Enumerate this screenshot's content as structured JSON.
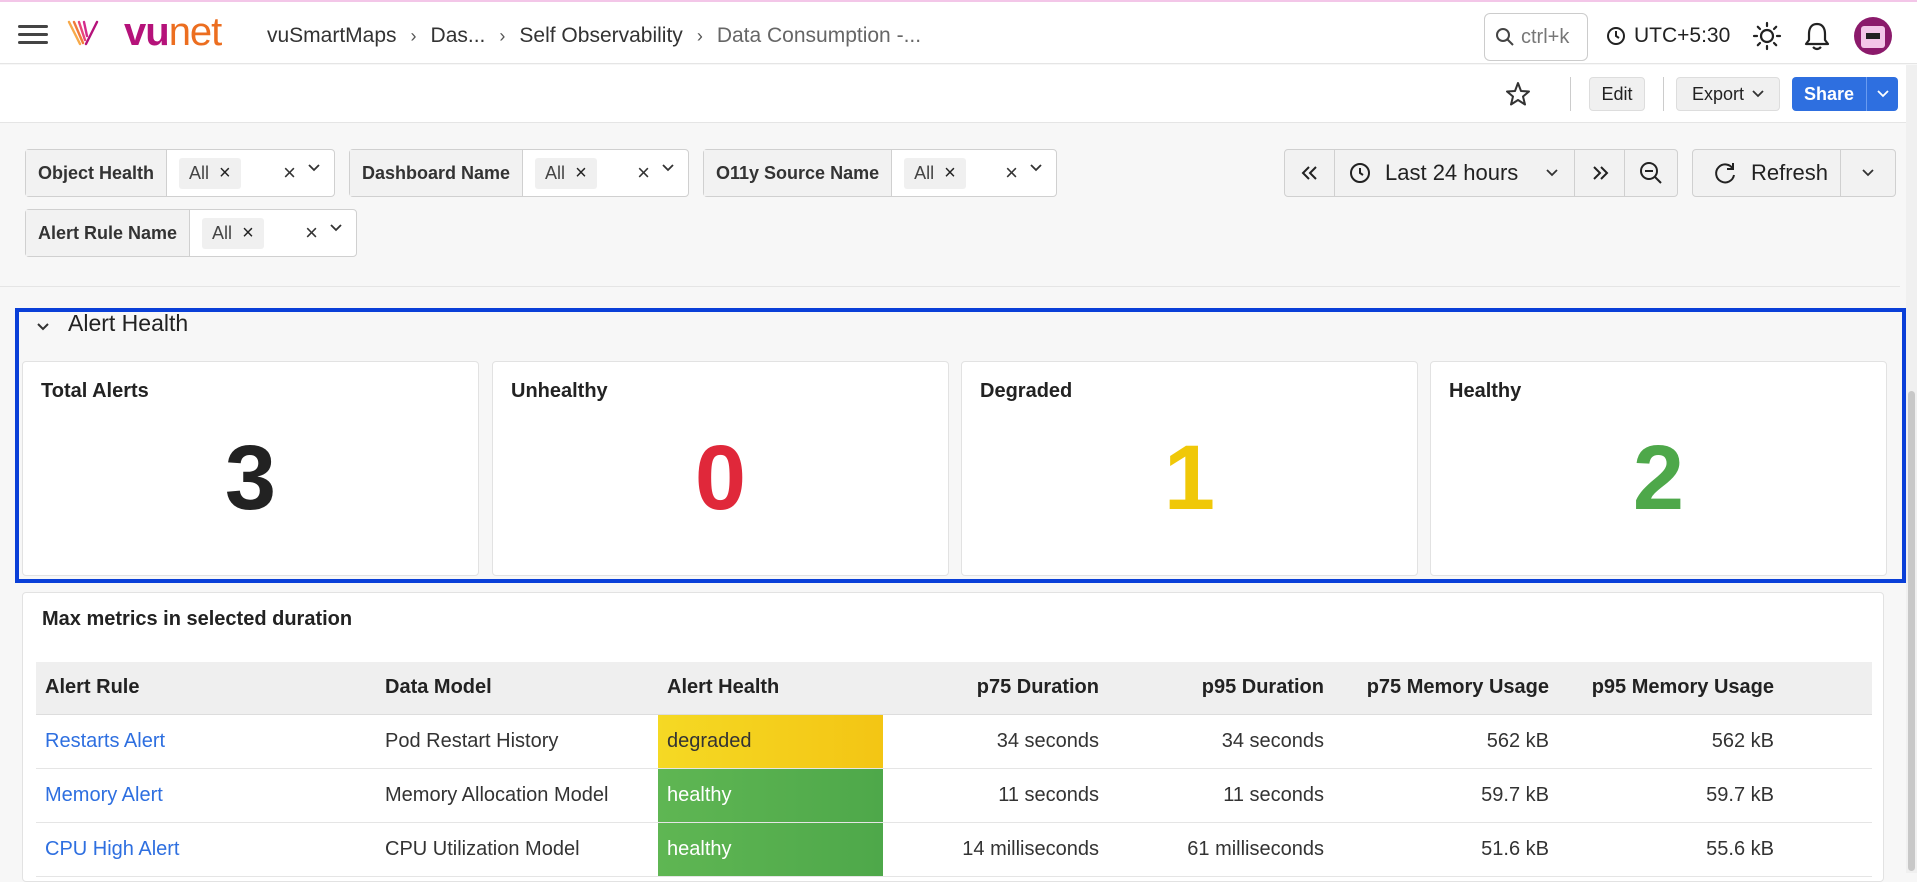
{
  "topbar": {
    "logo_text_vu": "vu",
    "logo_text_net": "net",
    "breadcrumb": [
      "vuSmartMaps",
      "Das...",
      "Self Observability",
      "Data Consumption -..."
    ],
    "search_placeholder": "ctrl+k",
    "timezone": "UTC+5:30",
    "brand_colors": {
      "vu": "#b5127a",
      "net": "#ec6e20"
    }
  },
  "toolbar": {
    "edit_label": "Edit",
    "export_label": "Export",
    "share_label": "Share"
  },
  "filters": [
    {
      "label": "Object Health",
      "value": "All"
    },
    {
      "label": "Dashboard Name",
      "value": "All"
    },
    {
      "label": "O11y Source Name",
      "value": "All"
    },
    {
      "label": "Alert Rule Name",
      "value": "All"
    }
  ],
  "time": {
    "range_label": "Last 24 hours",
    "refresh_label": "Refresh"
  },
  "alert_health": {
    "section_title": "Alert Health",
    "cards": [
      {
        "title": "Total Alerts",
        "value": "3",
        "color": "#222222"
      },
      {
        "title": "Unhealthy",
        "value": "0",
        "color": "#e0283a"
      },
      {
        "title": "Degraded",
        "value": "1",
        "color": "#f0c808"
      },
      {
        "title": "Healthy",
        "value": "2",
        "color": "#4ea84a"
      }
    ]
  },
  "metrics_table": {
    "title": "Max metrics in selected duration",
    "headers": [
      "Alert Rule",
      "Data Model",
      "Alert Health",
      "p75 Duration",
      "p95 Duration",
      "p75 Memory Usage",
      "p95 Memory Usage"
    ],
    "rows": [
      [
        "Restarts Alert",
        "Pod Restart History",
        "degraded",
        "34 seconds",
        "34 seconds",
        "562 kB",
        "562 kB"
      ],
      [
        "Memory Alert",
        "Memory Allocation Model",
        "healthy",
        "11 seconds",
        "11 seconds",
        "59.7 kB",
        "59.7 kB"
      ],
      [
        "CPU High Alert",
        "CPU Utilization Model",
        "healthy",
        "14 milliseconds",
        "61 milliseconds",
        "51.6 kB",
        "55.6 kB"
      ]
    ]
  }
}
